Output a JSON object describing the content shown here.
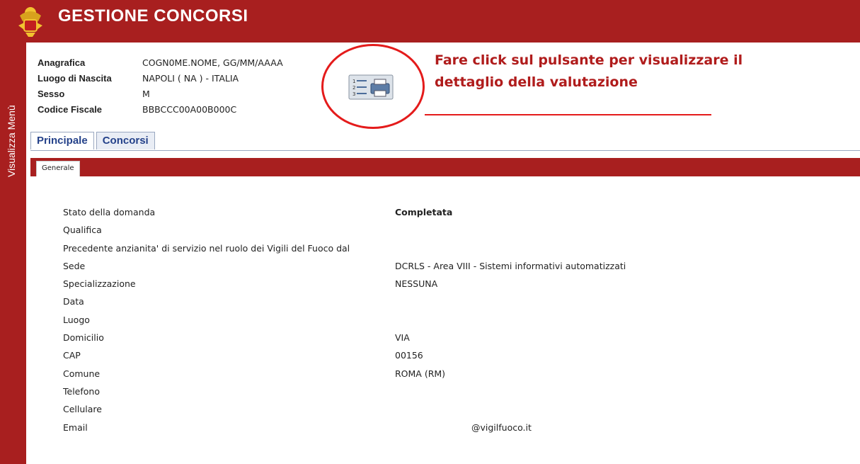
{
  "header": {
    "title": "GESTIONE CONCORSI"
  },
  "side_menu": {
    "label": "Visualizza Menù"
  },
  "anagrafica": [
    {
      "label": "Anagrafica",
      "value": "COGN0ME.NOME, GG/MM/AAAA"
    },
    {
      "label": "Luogo di Nascita",
      "value": "NAPOLI ( NA ) - ITALIA"
    },
    {
      "label": "Sesso",
      "value": "M"
    },
    {
      "label": "Codice Fiscale",
      "value": "BBBCCC00A00B000C"
    }
  ],
  "callout": {
    "line1": "Fare click sul pulsante per visualizzare il",
    "line2": "dettaglio della valutazione"
  },
  "tabs": [
    {
      "label": "Principale"
    },
    {
      "label": "Concorsi"
    }
  ],
  "subtab": {
    "label": "Generale"
  },
  "fields": [
    {
      "label": "Stato della domanda",
      "value": "Completata"
    },
    {
      "label": "Qualifica",
      "value": ""
    },
    {
      "label": "Precedente anzianita' di servizio nel ruolo dei Vigili del Fuoco dal",
      "value": ""
    },
    {
      "label": "Sede",
      "value": "DCRLS - Area VIII - Sistemi informativi automatizzati"
    },
    {
      "label": "Specializzazione",
      "value": "NESSUNA"
    },
    {
      "label": "Data",
      "value": ""
    },
    {
      "label": "Luogo",
      "value": ""
    },
    {
      "label": "Domicilio",
      "value": "VIA"
    },
    {
      "label": "CAP",
      "value": "00156"
    },
    {
      "label": "Comune",
      "value": "ROMA (RM)"
    },
    {
      "label": "Telefono",
      "value": ""
    },
    {
      "label": "Cellulare",
      "value": ""
    },
    {
      "label": "Email",
      "value": "@vigilfuoco.it"
    }
  ],
  "colors": {
    "brand_red": "#a81f1f",
    "annotation_red": "#e41b1b",
    "tab_blue": "#25428a"
  },
  "icons": {
    "logo": "firefighter-crest-icon",
    "detail_button": "print-list-icon"
  }
}
